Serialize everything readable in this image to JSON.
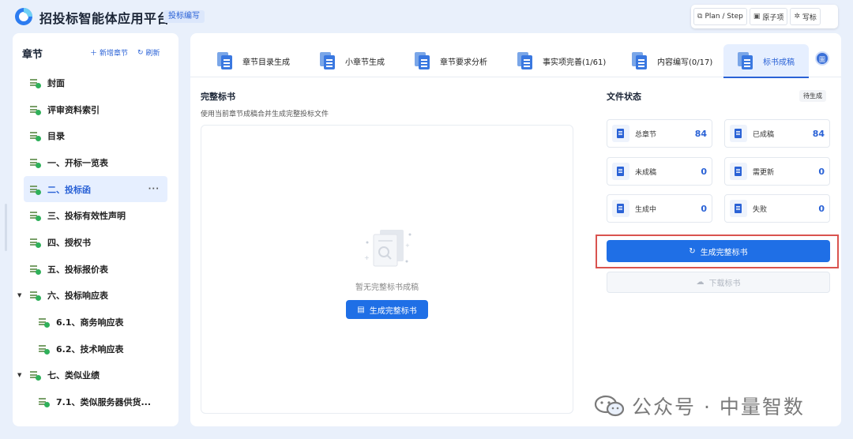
{
  "header": {
    "title": "招投标智能体应用平台",
    "mode_badge": "投标编写",
    "actions": [
      {
        "label": "Plan / Step",
        "icon": "sitemap-icon"
      },
      {
        "label": "原子项",
        "icon": "box-icon"
      },
      {
        "label": "写标",
        "icon": "bug-icon"
      }
    ]
  },
  "sidebar": {
    "title": "章节",
    "add_label": "新增章节",
    "refresh_label": "刷新",
    "items": [
      {
        "label": "封面",
        "level": 0
      },
      {
        "label": "评审资料索引",
        "level": 0
      },
      {
        "label": "目录",
        "level": 0
      },
      {
        "label": "一、开标一览表",
        "level": 0
      },
      {
        "label": "二、投标函",
        "level": 0,
        "active": true,
        "more": "···"
      },
      {
        "label": "三、投标有效性声明",
        "level": 0
      },
      {
        "label": "四、授权书",
        "level": 0
      },
      {
        "label": "五、投标报价表",
        "level": 0
      },
      {
        "label": "六、投标响应表",
        "level": 0,
        "expanded": true
      },
      {
        "label": "6.1、商务响应表",
        "level": 1
      },
      {
        "label": "6.2、技术响应表",
        "level": 1
      },
      {
        "label": "七、类似业绩",
        "level": 0,
        "expanded": true
      },
      {
        "label": "7.1、类似服务器供货...",
        "level": 1
      }
    ]
  },
  "tabs": [
    {
      "label": "章节目录生成"
    },
    {
      "label": "小章节生成"
    },
    {
      "label": "章节要求分析"
    },
    {
      "label": "事实项完善(1/61)"
    },
    {
      "label": "内容编写(0/17)"
    },
    {
      "label": "标书成稿",
      "active": true
    }
  ],
  "avatar_text": "圖",
  "left_panel": {
    "title": "完整标书",
    "desc": "使用当前章节成稿合并生成完整投标文件",
    "empty_text": "暂无完整标书成稿",
    "generate_label": "生成完整标书"
  },
  "right_panel": {
    "title": "文件状态",
    "status_badge": "待生成",
    "stats": [
      {
        "label": "总章节",
        "value": "84"
      },
      {
        "label": "已成稿",
        "value": "84"
      },
      {
        "label": "未成稿",
        "value": "0"
      },
      {
        "label": "需更新",
        "value": "0"
      },
      {
        "label": "生成中",
        "value": "0"
      },
      {
        "label": "失败",
        "value": "0"
      }
    ],
    "generate_label": "生成完整标书",
    "download_label": "下载标书"
  },
  "watermark": "公众号 · 中量智数",
  "colors": {
    "accent": "#1f6fe6",
    "highlight": "#d9534f",
    "bg": "#e9f0fb"
  }
}
